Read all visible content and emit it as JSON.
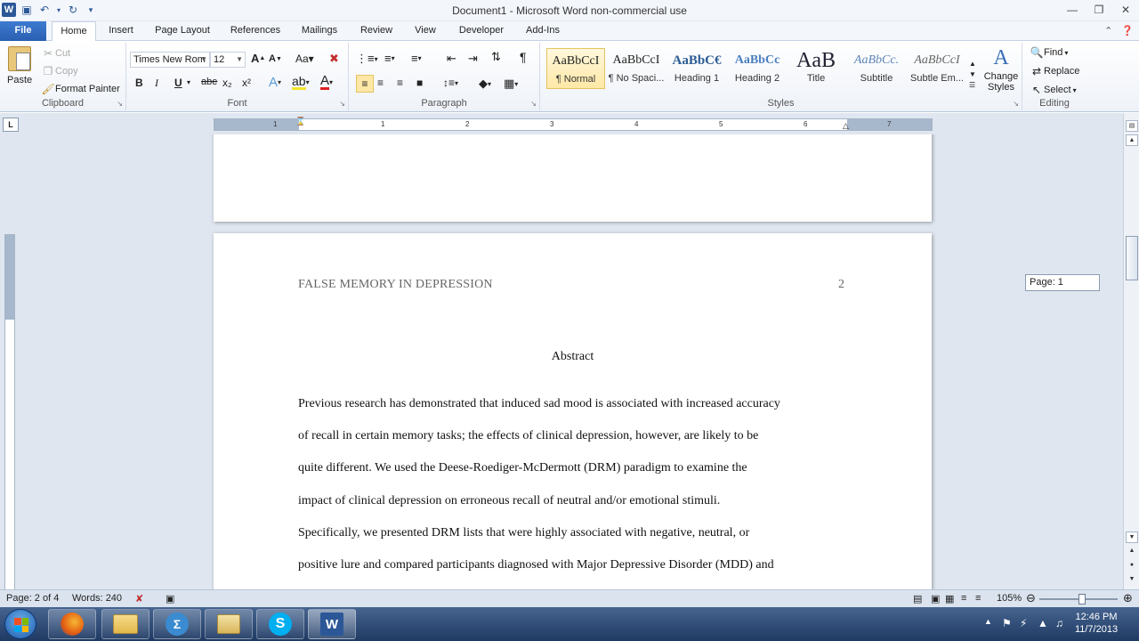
{
  "window": {
    "title": "Document1  -  Microsoft Word non-commercial use"
  },
  "ribbon_tabs": [
    "File",
    "Home",
    "Insert",
    "Page Layout",
    "References",
    "Mailings",
    "Review",
    "View",
    "Developer",
    "Add-Ins"
  ],
  "clipboard": {
    "paste": "Paste",
    "cut": "Cut",
    "copy": "Copy",
    "format_painter": "Format Painter",
    "label": "Clipboard"
  },
  "font": {
    "family": "Times New Rom",
    "size": "12",
    "label": "Font",
    "bold": "B",
    "italic": "I",
    "underline": "U",
    "strike": "abe",
    "subscript": "x₂",
    "superscript": "x²"
  },
  "paragraph": {
    "label": "Paragraph"
  },
  "styles": {
    "label": "Styles",
    "items": [
      {
        "sample": "AaBbCcI",
        "name": "¶ Normal"
      },
      {
        "sample": "AaBbCcI",
        "name": "¶ No Spaci..."
      },
      {
        "sample": "AaBbC€",
        "name": "Heading 1"
      },
      {
        "sample": "AaBbCc",
        "name": "Heading 2"
      },
      {
        "sample": "AaB",
        "name": "Title"
      },
      {
        "sample": "AaBbCc.",
        "name": "Subtitle"
      },
      {
        "sample": "AaBbCcI",
        "name": "Subtle Em..."
      }
    ],
    "change_styles": "Change Styles"
  },
  "editing": {
    "find": "Find",
    "replace": "Replace",
    "select": "Select",
    "label": "Editing"
  },
  "ruler_numbers": [
    "1",
    "1",
    "2",
    "3",
    "4",
    "5",
    "6",
    "7"
  ],
  "document": {
    "running_head": "FALSE MEMORY IN DEPRESSION",
    "page_number": "2",
    "heading": "Abstract",
    "lines": [
      "Previous research has demonstrated that induced sad mood is associated with increased accuracy",
      "of recall in certain memory tasks; the effects of clinical depression, however, are likely to be",
      "quite different. We used the Deese-Roediger-McDermott (DRM) paradigm to examine the",
      "impact of clinical depression on erroneous recall of neutral and/or emotional stimuli.",
      "Specifically, we presented DRM lists that were highly associated with negative, neutral, or",
      "positive lure and compared participants diagnosed with Major Depressive Disorder (MDD) and"
    ]
  },
  "page_tooltip": "Page: 1",
  "status": {
    "page": "Page: 2 of 4",
    "words": "Words: 240",
    "zoom": "105%"
  },
  "tray": {
    "time": "12:46 PM",
    "date": "11/7/2013"
  }
}
